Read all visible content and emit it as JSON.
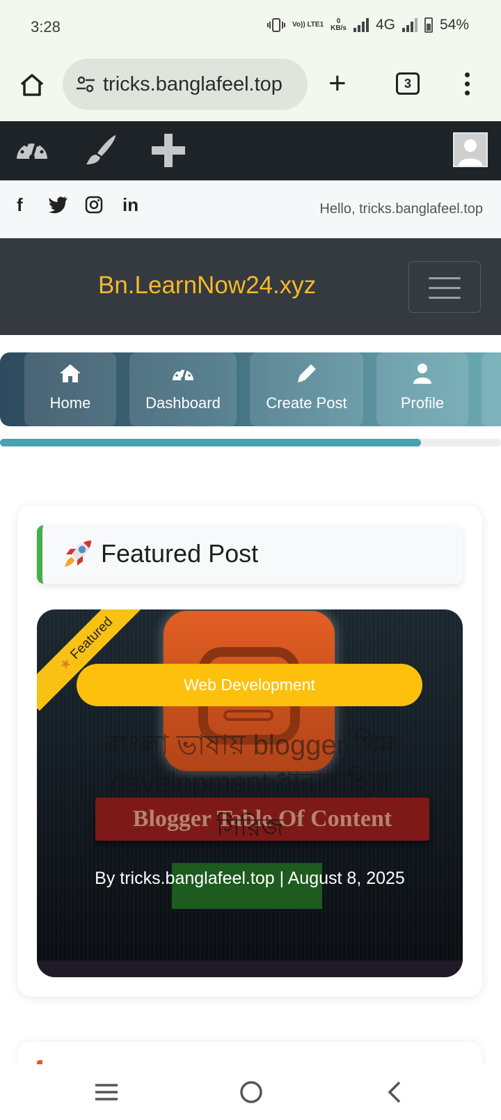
{
  "status_bar": {
    "time": "3:28",
    "volte": "Vo)) LTE1",
    "speed_value": "0",
    "speed_unit": "KB/s",
    "network": "4G",
    "battery": "54%"
  },
  "browser": {
    "url": "tricks.banglafeel.top",
    "tab_count": "3"
  },
  "social": {
    "icons": [
      "facebook-icon",
      "twitter-icon",
      "instagram-icon",
      "linkedin-icon"
    ],
    "facebook": "f",
    "linkedin": "in",
    "greeting": "Hello, tricks.banglafeel.top"
  },
  "site": {
    "brand": "Bn.LearnNow24.xyz",
    "brand_color": "#f6b82a"
  },
  "nav": {
    "items": [
      {
        "label": "Home",
        "icon": "home-icon"
      },
      {
        "label": "Dashboard",
        "icon": "dashboard-icon"
      },
      {
        "label": "Create Post",
        "icon": "pencil-icon"
      },
      {
        "label": "Profile",
        "icon": "user-icon"
      }
    ],
    "reading_progress": 0.84
  },
  "featured": {
    "heading": "Featured Post",
    "ribbon": "Featured",
    "category": "Web Development",
    "title": "বাংলা ভাষায় blogger থিম development ধারাবাহিক",
    "title_series": "সিরিজ",
    "banner_text": "Blogger Table Of Content",
    "meta": "By tricks.banglafeel.top | August 8, 2025"
  }
}
